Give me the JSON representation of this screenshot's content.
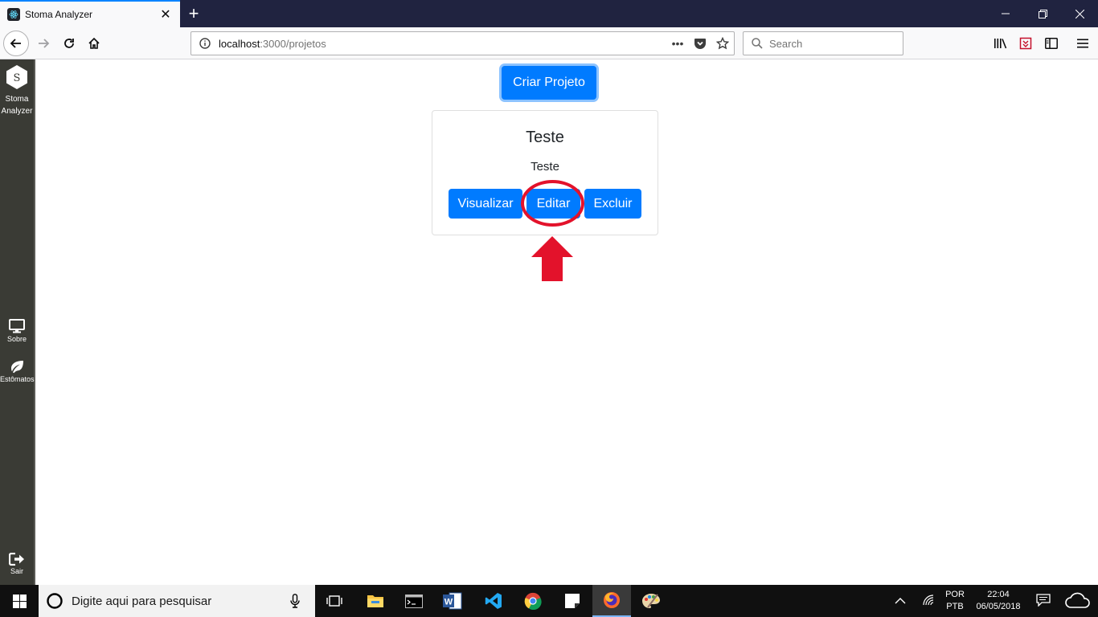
{
  "browser": {
    "tab_title": "Stoma Analyzer",
    "url_host": "localhost",
    "url_path": ":3000/projetos",
    "search_placeholder": "Search",
    "page_actions_glyph": "•••"
  },
  "sidebar": {
    "logo_letter": "S",
    "brand_line1": "Stoma",
    "brand_line2": "Analyzer",
    "items": [
      {
        "label": "Sobre",
        "icon": "monitor-icon"
      },
      {
        "label": "Estômatos",
        "icon": "leaf-icon"
      },
      {
        "label": "Sair",
        "icon": "sign-out-icon"
      }
    ]
  },
  "main": {
    "create_button": "Criar Projeto",
    "card": {
      "title": "Teste",
      "description": "Teste",
      "view_button": "Visualizar",
      "edit_button": "Editar",
      "delete_button": "Excluir"
    },
    "annotation_color": "#e3122b",
    "primary_color": "#007bff"
  },
  "taskbar": {
    "search_placeholder": "Digite aqui para pesquisar",
    "language_line1": "POR",
    "language_line2": "PTB",
    "time": "22:04",
    "date": "06/05/2018"
  }
}
